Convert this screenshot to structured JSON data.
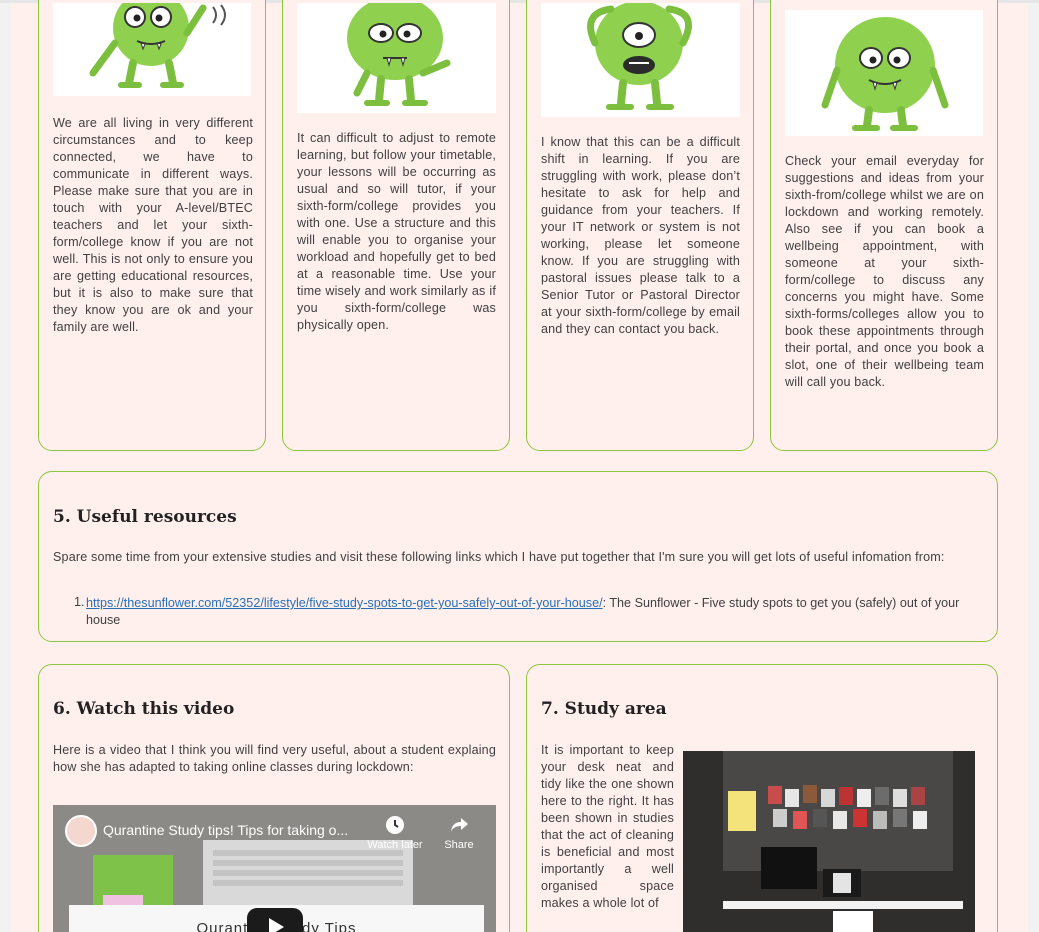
{
  "cards_top": [
    {
      "text": "We are all living in very different circumstances and to keep connected, we have to communicate in different ways. Please make sure that you are in touch with your A-level/BTEC teachers and let your sixth-form/college know if you are not well. This is not only to ensure you are getting educational resources, but it is also to make sure that they know you are ok and your family are well."
    },
    {
      "text": "It can difficult to adjust to remote learning, but follow your timetable, your lessons will be occurring as usual and so will tutor, if your sixth-form/college provides you with one. Use a structure and this will enable you to organise your workload and hopefully get to bed at a reasonable time. Use your time wisely and work similarly as if you sixth-form/college was physically open."
    },
    {
      "text": "I know that this can be a difficult shift in learning. If you are struggling with work, please don’t hesitate to ask for help and guidance from your teachers. If your IT network or system is not working, please let someone know. If you are struggling with pastoral issues please talk to a Senior Tutor or Pastoral Director at your sixth-form/college by email and they can contact you back."
    },
    {
      "text": "Check your email everyday for suggestions and ideas from your sixth-from/college whilst we are on lockdown and working remotely. Also see if you can book a wellbeing appointment, with someone at your sixth-form/college to discuss any concerns you might have. Some sixth-forms/colleges allow you to book these appointments through their portal, and once you book a slot, one of their wellbeing team will call you back."
    }
  ],
  "resources": {
    "heading": "5. Useful resources",
    "intro": "Spare some time from your extensive studies and visit these following links which I have put together that I'm sure you will get lots of useful infomation from:",
    "item_number": "1.",
    "link_text": "https://thesunflower.com/52352/lifestyle/five-study-spots-to-get-you-safely-out-of-your-house/",
    "link_suffix": ": The Sunflower - Five study spots to get you (safely) out of your house"
  },
  "video_section": {
    "heading": "6. Watch this video",
    "intro": "Here is a video that I think you will find very useful, about a student explaing how she has adapted to taking online classes during lockdown:",
    "video_title": "Qurantine Study tips! Tips for taking o...",
    "watch_later": "Watch later",
    "share": "Share",
    "caption": "Qurantine Study Tips"
  },
  "study_area": {
    "heading": "7. Study area",
    "text": "It is important to keep your desk neat and tidy like the one shown here to the right. It has been shown in studies that the act of cleaning is beneficial and most importantly a well organised space makes a whole lot of"
  },
  "colors": {
    "accent_border": "#8cc63f",
    "monster_green": "#8fd14f",
    "link": "#2a6fb5",
    "page_bg": "#fff0ee"
  }
}
